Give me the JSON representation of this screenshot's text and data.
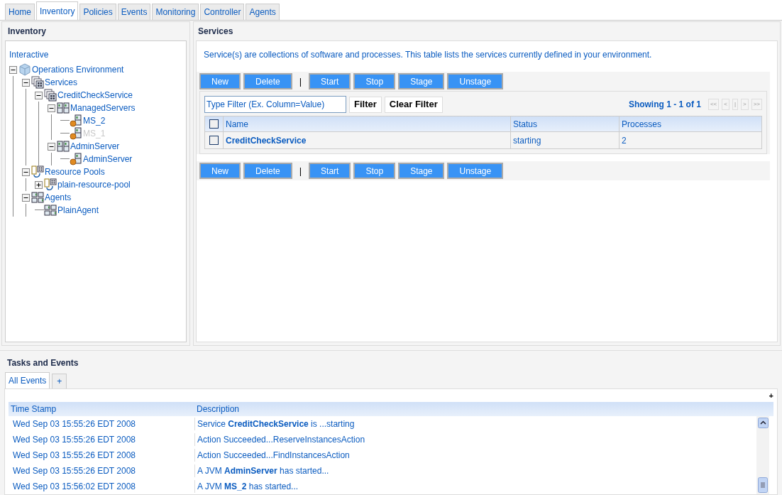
{
  "tabs": [
    {
      "label": "Home",
      "selected": false
    },
    {
      "label": "Inventory",
      "selected": true
    },
    {
      "label": "Policies",
      "selected": false
    },
    {
      "label": "Events",
      "selected": false
    },
    {
      "label": "Monitoring",
      "selected": false
    },
    {
      "label": "Controller",
      "selected": false
    },
    {
      "label": "Agents",
      "selected": false
    }
  ],
  "inventory": {
    "title": "Inventory",
    "mode": "Interactive",
    "tree": [
      {
        "label": "Operations Environment",
        "kind": "environment",
        "expanded": true,
        "disabled": false,
        "children": [
          {
            "label": "Services",
            "kind": "services",
            "expanded": true,
            "disabled": false,
            "children": [
              {
                "label": "CreditCheckService",
                "kind": "services",
                "expanded": true,
                "disabled": false,
                "children": [
                  {
                    "label": "ManagedServers",
                    "kind": "group",
                    "expanded": true,
                    "disabled": false,
                    "children": [
                      {
                        "label": "MS_2",
                        "kind": "server",
                        "disabled": false
                      },
                      {
                        "label": "MS_1",
                        "kind": "server",
                        "disabled": true
                      }
                    ]
                  },
                  {
                    "label": "AdminServer",
                    "kind": "group",
                    "expanded": true,
                    "disabled": false,
                    "children": [
                      {
                        "label": "AdminServer",
                        "kind": "server",
                        "disabled": false
                      }
                    ]
                  }
                ]
              }
            ]
          },
          {
            "label": "Resource Pools",
            "kind": "pool",
            "expanded": true,
            "disabled": false,
            "children": [
              {
                "label": "plain-resource-pool",
                "kind": "pool",
                "expanded": false,
                "disabled": false
              }
            ]
          },
          {
            "label": "Agents",
            "kind": "agents",
            "expanded": true,
            "disabled": false,
            "children": [
              {
                "label": "PlainAgent",
                "kind": "agents",
                "disabled": false
              }
            ]
          }
        ]
      }
    ]
  },
  "services": {
    "title": "Services",
    "intro": "Service(s) are collections of software and processes. This table lists the services currently defined in your environment.",
    "toolbar": [
      {
        "kind": "button",
        "label": "New"
      },
      {
        "kind": "button",
        "label": "Delete"
      },
      {
        "kind": "separator",
        "label": "|"
      },
      {
        "kind": "button",
        "label": "Start"
      },
      {
        "kind": "button",
        "label": "Stop"
      },
      {
        "kind": "button",
        "label": "Stage"
      },
      {
        "kind": "button",
        "label": "Unstage"
      }
    ],
    "filter": {
      "placeholder": "Type Filter (Ex. Column=Value)",
      "buttons": [
        "Filter",
        "Clear Filter"
      ]
    },
    "pager": {
      "showing": "Showing 1 - 1 of 1",
      "controls": [
        "<<",
        "<",
        "|",
        ">",
        ">>"
      ]
    },
    "table": {
      "columns": [
        "Name",
        "Status",
        "Processes"
      ],
      "header_checked": false,
      "rows": [
        {
          "checked": false,
          "cells": [
            "CreditCheckService",
            "starting",
            "2"
          ]
        }
      ]
    },
    "toolbar_bottom": [
      {
        "kind": "button",
        "label": "New"
      },
      {
        "kind": "button",
        "label": "Delete"
      },
      {
        "kind": "separator",
        "label": "|"
      },
      {
        "kind": "button",
        "label": "Start"
      },
      {
        "kind": "button",
        "label": "Stop"
      },
      {
        "kind": "button",
        "label": "Stage"
      },
      {
        "kind": "button",
        "label": "Unstage"
      }
    ]
  },
  "tasks": {
    "title": "Tasks and Events",
    "tabs": [
      {
        "label": "All Events",
        "selected": true
      },
      {
        "label": "+",
        "selected": false
      }
    ],
    "corner": "+",
    "columns": [
      "Time Stamp",
      "Description"
    ],
    "rows": [
      {
        "time": "Wed Sep 03 15:55:26 EDT 2008",
        "description": "Service **CreditCheckService** is ...starting"
      },
      {
        "time": "Wed Sep 03 15:55:26 EDT 2008",
        "description": "Action Succeeded...ReserveInstancesAction"
      },
      {
        "time": "Wed Sep 03 15:55:26 EDT 2008",
        "description": "Action Succeeded...FindInstancesAction"
      },
      {
        "time": "Wed Sep 03 15:55:26 EDT 2008",
        "description": "A JVM **AdminServer** has started..."
      },
      {
        "time": "Wed Sep 03 15:56:02 EDT 2008",
        "description": "A JVM **MS_2** has started..."
      }
    ]
  }
}
